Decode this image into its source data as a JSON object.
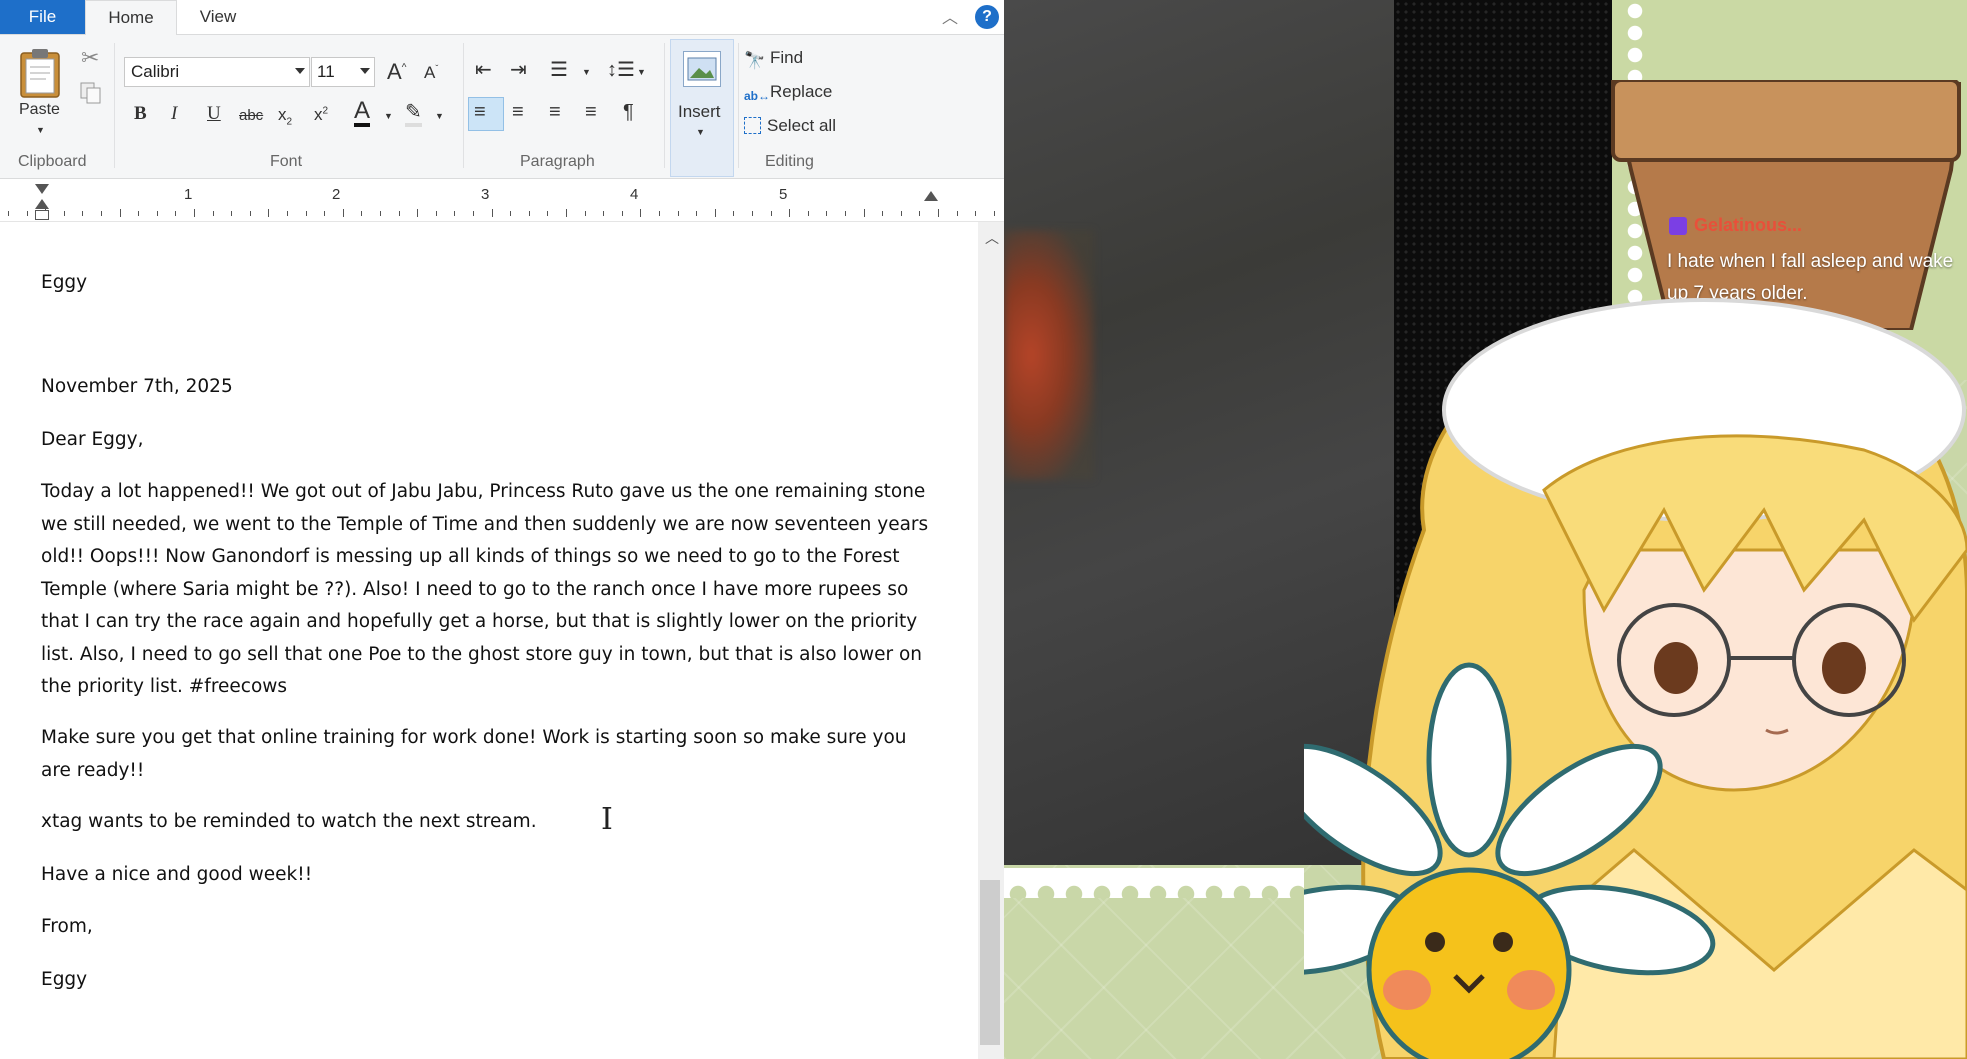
{
  "tabs": {
    "file": "File",
    "home": "Home",
    "view": "View"
  },
  "ribbon": {
    "clipboard": {
      "paste": "Paste",
      "group_label": "Clipboard"
    },
    "font": {
      "family": "Calibri",
      "size": "11",
      "group_label": "Font"
    },
    "paragraph": {
      "group_label": "Paragraph"
    },
    "insert": {
      "label": "Insert"
    },
    "editing": {
      "find": "Find",
      "replace": "Replace",
      "select_all": "Select all",
      "group_label": "Editing"
    }
  },
  "ruler": {
    "marks": [
      "1",
      "2",
      "3",
      "4",
      "5"
    ]
  },
  "document": {
    "line1": "Eggy",
    "date": "November 7th, 2025",
    "greeting": "Dear Eggy,",
    "para1": "Today a lot happened!! We got out of Jabu Jabu, Princess Ruto gave us the one remaining stone we still needed, we went to the Temple of Time and then suddenly we are now seventeen years old!! Oops!!! Now Ganondorf is messing up all kinds of things so we need to go to the Forest Temple (where Saria might be ??). Also! I need to go to the ranch once I have more rupees so that I can try the race again and hopefully get a horse, but that is slightly lower on the priority list. Also, I need to go sell that one Poe to the ghost store guy in town, but that is also lower on the priority list. #freecows",
    "para2": "Make sure you get that online training for work done! Work is starting soon so make sure you are ready!!",
    "para3": "xtag wants to be reminded to watch the next stream.",
    "para4": "Have a nice and good week!!",
    "closing": "From,",
    "signature": "Eggy"
  },
  "stream": {
    "chat_user": "Gelatinous...",
    "chat_message": "I hate when I fall asleep and wake up 7 years older."
  },
  "colors": {
    "file_tab": "#1e6fc9",
    "chat_user": "#e8503a",
    "overlay_bg": "#c9d7a8"
  }
}
